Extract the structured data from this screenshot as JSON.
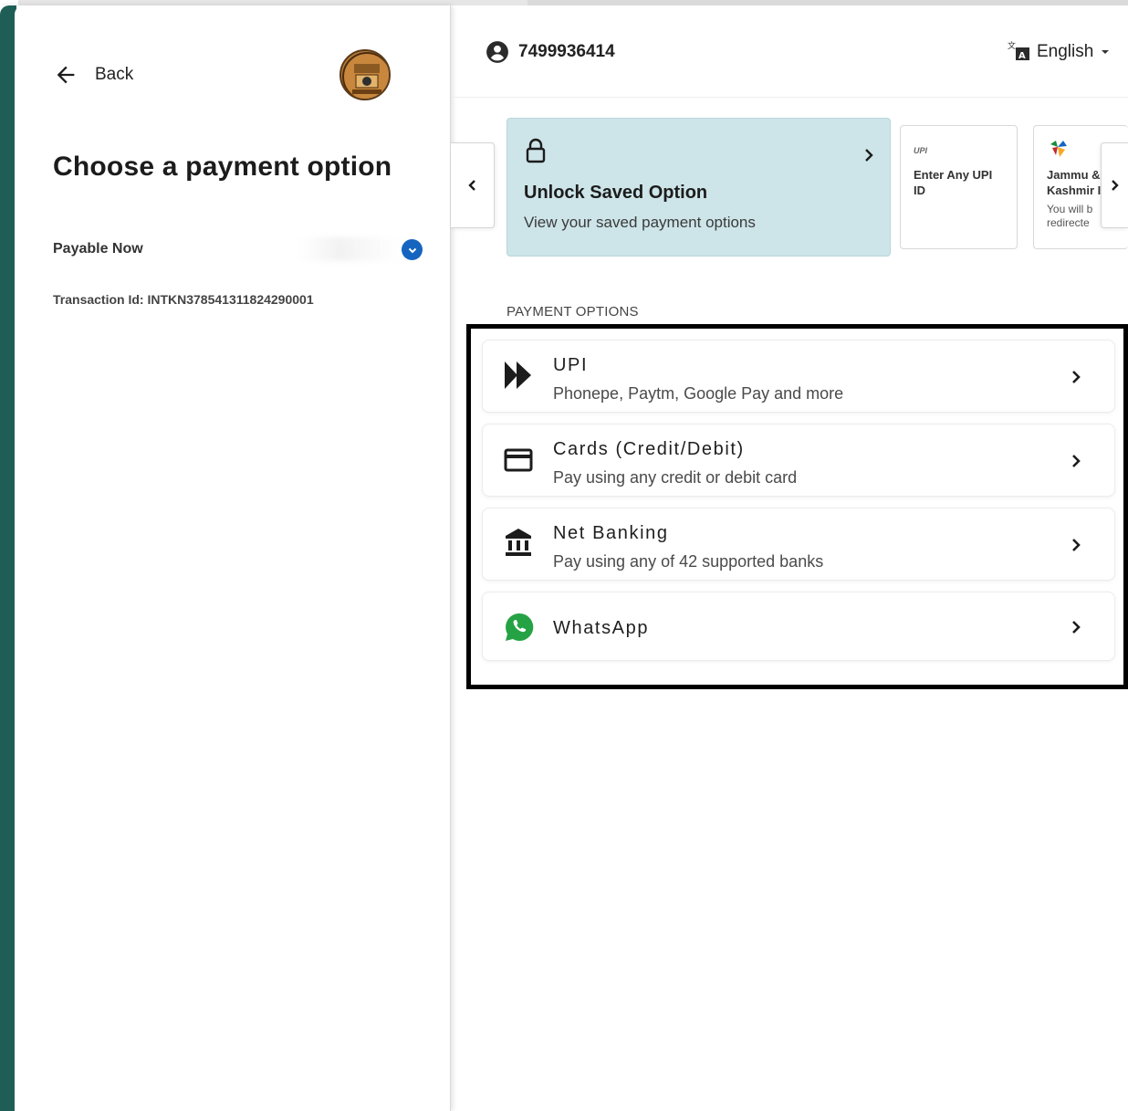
{
  "left": {
    "back_label": "Back",
    "title": "Choose a payment option",
    "payable_label": "Payable Now",
    "transaction_id": "Transaction Id: INTKN378541311824290001"
  },
  "header": {
    "phone": "7499936414",
    "language": "English"
  },
  "carousel": {
    "saved": {
      "title": "Unlock Saved Option",
      "subtitle": "View your saved payment options"
    },
    "upi_card": {
      "logo_text": "UPI",
      "title_line1": "Enter Any UPI",
      "title_line2": "ID"
    },
    "jk_card": {
      "title_line1": "Jammu &",
      "title_line2": "Kashmir I",
      "sub_line1": "You will b",
      "sub_line2": "redirecte"
    }
  },
  "payment_options": {
    "heading": "PAYMENT OPTIONS",
    "items": [
      {
        "title": "UPI",
        "subtitle": "Phonepe, Paytm, Google Pay and more",
        "icon": "double-chevron-icon"
      },
      {
        "title": "Cards (Credit/Debit)",
        "subtitle": "Pay using any credit or debit card",
        "icon": "card-icon"
      },
      {
        "title": "Net Banking",
        "subtitle": "Pay using any of 42 supported banks",
        "icon": "bank-icon"
      },
      {
        "title": "WhatsApp",
        "subtitle": "",
        "icon": "whatsapp-icon"
      }
    ]
  },
  "colors": {
    "accent_dark_green": "#1f5e56",
    "saved_card_bg": "#cde5e9",
    "toggle_blue": "#1565c0",
    "whatsapp_green": "#25a244"
  }
}
